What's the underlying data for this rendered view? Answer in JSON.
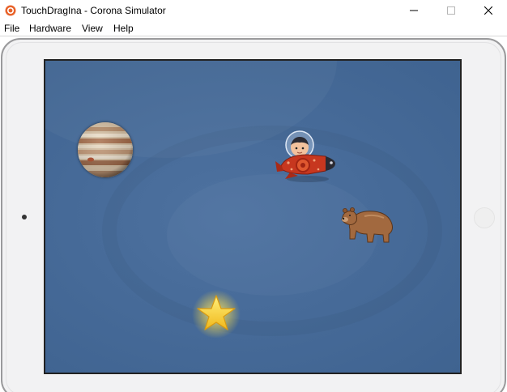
{
  "window": {
    "title": "TouchDragIna - Corona Simulator",
    "icon": "corona-logo-icon",
    "controls": [
      "minimize-icon",
      "maximize-icon",
      "close-icon"
    ]
  },
  "menu": {
    "items": [
      "File",
      "Hardware",
      "View",
      "Help"
    ]
  },
  "device": {
    "type": "tablet-skin",
    "screen_background": "#476b99",
    "sprites": [
      {
        "name": "jupiter",
        "icon": "planet-jupiter-icon"
      },
      {
        "name": "astronaut-rocket",
        "icon": "rocket-astronaut-icon"
      },
      {
        "name": "bear",
        "icon": "bear-icon"
      },
      {
        "name": "star",
        "icon": "star-icon"
      }
    ]
  },
  "colors": {
    "screen_blue": "#476b99",
    "corona_orange": "#e8632b",
    "star_yellow": "#f6c825"
  }
}
